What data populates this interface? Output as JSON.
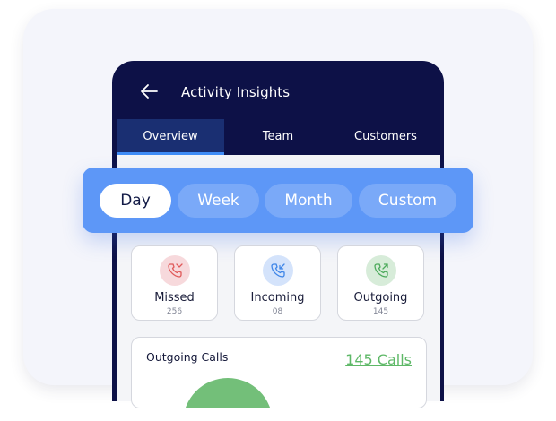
{
  "header": {
    "title": "Activity Insights"
  },
  "tabs": [
    {
      "label": "Overview",
      "active": true
    },
    {
      "label": "Team",
      "active": false
    },
    {
      "label": "Customers",
      "active": false
    }
  ],
  "range_filter": {
    "options": [
      "Day",
      "Week",
      "Month",
      "Custom"
    ],
    "selected": "Day"
  },
  "stats": [
    {
      "label": "Missed",
      "count": "256",
      "icon": "missed-call-icon",
      "color": "#e05a5a"
    },
    {
      "label": "Incoming",
      "count": "08",
      "icon": "incoming-call-icon",
      "color": "#3f86e8"
    },
    {
      "label": "Outgoing",
      "count": "145",
      "icon": "outgoing-call-icon",
      "color": "#4caa5b"
    }
  ],
  "outgoing_card": {
    "title": "Outgoing Calls",
    "total": "145 Calls"
  },
  "colors": {
    "phone_bg": "#0d1147",
    "active_tab": "#1a2f72",
    "accent_blue": "#3f8cf6",
    "range_bar": "#5d97f7",
    "green": "#5eb867"
  }
}
